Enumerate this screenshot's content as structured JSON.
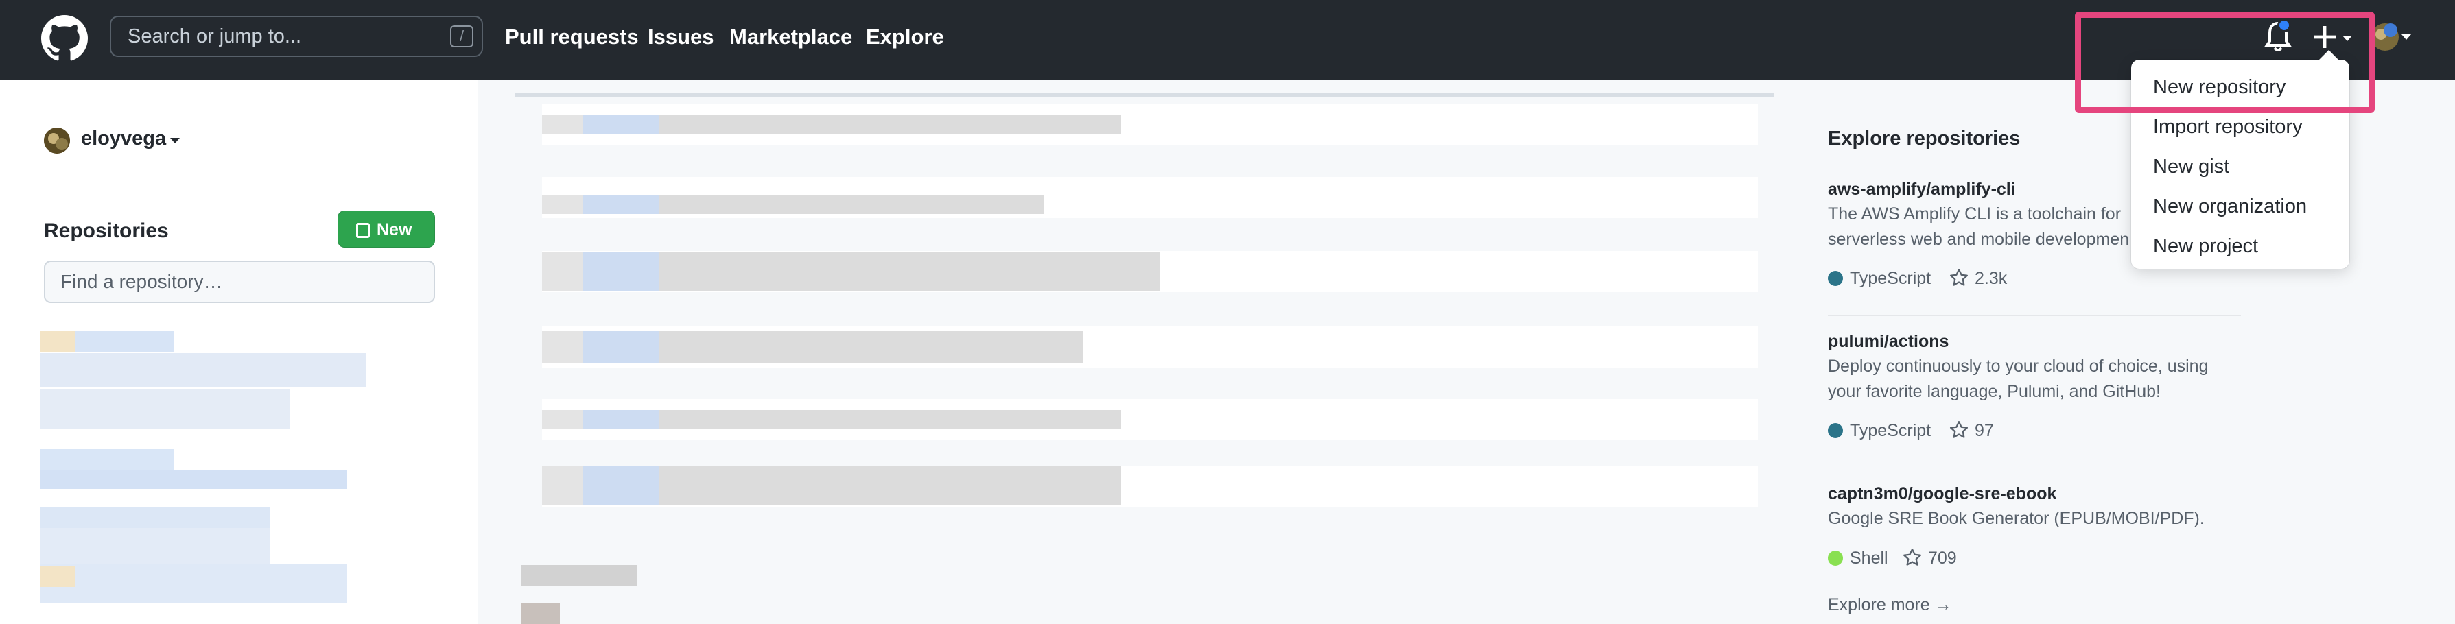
{
  "header": {
    "search_placeholder": "Search or jump to...",
    "search_shortcut": "/",
    "nav": [
      "Pull requests",
      "Issues",
      "Marketplace",
      "Explore"
    ],
    "plus_label": "+"
  },
  "dropdown": {
    "items": [
      "New repository",
      "Import repository",
      "New gist",
      "New organization",
      "New project"
    ]
  },
  "sidebar": {
    "username": "eloyvega",
    "repositories_heading": "Repositories",
    "new_button": "New",
    "find_placeholder": "Find a repository…"
  },
  "explore": {
    "heading": "Explore repositories",
    "repos": [
      {
        "name": "aws-amplify/amplify-cli",
        "description": "The AWS Amplify CLI is a toolchain for serverless web and mobile developmen",
        "language": "TypeScript",
        "language_color": "#2b7489",
        "stars": "2.3k"
      },
      {
        "name": "pulumi/actions",
        "description": "Deploy continuously to your cloud of choice, using your favorite language, Pulumi, and GitHub!",
        "language": "TypeScript",
        "language_color": "#2b7489",
        "stars": "97"
      },
      {
        "name": "captn3m0/google-sre-ebook",
        "description": "Google SRE Book Generator (EPUB/MOBI/PDF).",
        "language": "Shell",
        "language_color": "#89e051",
        "stars": "709"
      }
    ],
    "more": "Explore more →"
  },
  "colors": {
    "header_bg": "#24292f",
    "highlight": "#e5457e",
    "new_button": "#2da44e",
    "notification_dot": "#2f81f7"
  }
}
